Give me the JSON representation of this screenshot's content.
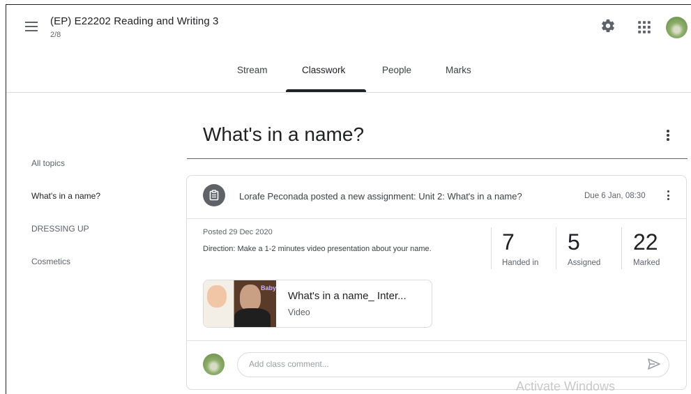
{
  "header": {
    "class_title": "(EP) E22202 Reading and Writing 3",
    "class_subtitle": "2/8",
    "icons": [
      "menu-icon",
      "gear-icon",
      "apps-grid-icon",
      "avatar"
    ]
  },
  "tabs": [
    {
      "label": "Stream",
      "active": false
    },
    {
      "label": "Classwork",
      "active": true
    },
    {
      "label": "People",
      "active": false
    },
    {
      "label": "Marks",
      "active": false
    }
  ],
  "sidebar": {
    "items": [
      {
        "label": "All topics",
        "active": false
      },
      {
        "label": "What's in a name?",
        "active": true
      },
      {
        "label": "DRESSING UP",
        "active": false
      },
      {
        "label": "Cosmetics",
        "active": false
      }
    ]
  },
  "topic": {
    "title": "What's in a name?"
  },
  "assignment": {
    "title": "Lorafe Peconada posted a new assignment: Unit 2: What's in a name?",
    "due": "Due 6 Jan, 08:30",
    "posted": "Posted 29 Dec 2020",
    "direction": "Direction: Make a 1-2 minutes video presentation about your name.",
    "stats": [
      {
        "value": "7",
        "label": "Handed in"
      },
      {
        "value": "5",
        "label": "Assigned"
      },
      {
        "value": "22",
        "label": "Marked"
      }
    ],
    "attachment": {
      "title": "What's in a name_ Inter...",
      "type": "Video",
      "thumb_text": "Baby"
    }
  },
  "comment": {
    "placeholder": "Add class comment..."
  },
  "watermark": "Activate Windows",
  "colors": {
    "text_primary": "#202124",
    "text_secondary": "#5f6368",
    "divider": "#dadce0"
  }
}
